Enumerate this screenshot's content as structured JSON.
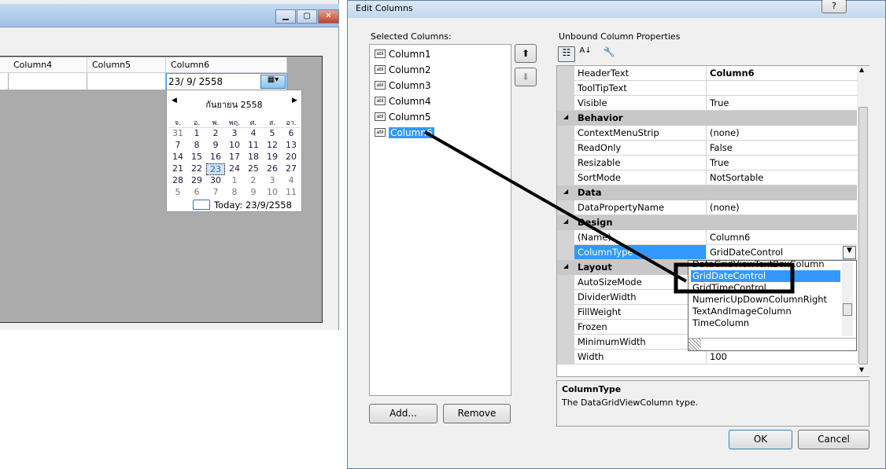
{
  "left_window": {
    "columns": [
      "Column4",
      "Column5",
      "Column6"
    ],
    "date_value": "23/ 9/ 2558",
    "calendar": {
      "month_title": "กันยายน 2558",
      "weekdays": [
        "จ.",
        "อ.",
        "พ.",
        "พฤ.",
        "ศ.",
        "ส.",
        "อา."
      ],
      "weeks": [
        [
          "31",
          "1",
          "2",
          "3",
          "4",
          "5",
          "6"
        ],
        [
          "7",
          "8",
          "9",
          "10",
          "11",
          "12",
          "13"
        ],
        [
          "14",
          "15",
          "16",
          "17",
          "18",
          "19",
          "20"
        ],
        [
          "21",
          "22",
          "23",
          "24",
          "25",
          "26",
          "27"
        ],
        [
          "28",
          "29",
          "30",
          "1",
          "2",
          "3",
          "4"
        ],
        [
          "5",
          "6",
          "7",
          "8",
          "9",
          "10",
          "11"
        ]
      ],
      "selected_day": "23",
      "today": "Today: 23/9/2558"
    }
  },
  "dialog": {
    "title": "Edit Columns",
    "help": "?",
    "selected_columns_label": "Selected Columns:",
    "columns": [
      "Column1",
      "Column2",
      "Column3",
      "Column4",
      "Column5",
      "Column6"
    ],
    "selected_column": "Column6",
    "add": "Add...",
    "remove": "Remove",
    "properties_label": "Unbound Column Properties",
    "properties": [
      {
        "name": "HeaderText",
        "value": "Column6"
      },
      {
        "name": "ToolTipText",
        "value": ""
      },
      {
        "name": "Visible",
        "value": "True"
      },
      {
        "category": "Behavior"
      },
      {
        "name": "ContextMenuStrip",
        "value": "(none)"
      },
      {
        "name": "ReadOnly",
        "value": "False"
      },
      {
        "name": "Resizable",
        "value": "True"
      },
      {
        "name": "SortMode",
        "value": "NotSortable"
      },
      {
        "category": "Data"
      },
      {
        "name": "DataPropertyName",
        "value": "(none)"
      },
      {
        "category": "Design"
      },
      {
        "name": "(Name)",
        "value": "Column6"
      },
      {
        "name": "ColumnType",
        "value": "GridDateControl"
      },
      {
        "category": "Layout"
      },
      {
        "name": "AutoSizeMode",
        "value": ""
      },
      {
        "name": "DividerWidth",
        "value": ""
      },
      {
        "name": "FillWeight",
        "value": ""
      },
      {
        "name": "Frozen",
        "value": ""
      },
      {
        "name": "MinimumWidth",
        "value": ""
      },
      {
        "name": "Width",
        "value": "100"
      }
    ],
    "dropdown_options": [
      "DataGridViewTextBoxColumn",
      "GridDateControl",
      "GridTimeControl",
      "NumericUpDownColumnRight",
      "TextAndImageColumn",
      "TimeColumn"
    ],
    "dropdown_selected": "GridDateControl",
    "description_title": "ColumnType",
    "description_text": "The DataGridViewColumn type.",
    "ok": "OK",
    "cancel": "Cancel"
  },
  "colors": {
    "selection": "#3399ff",
    "grid_bg": "#ababab"
  }
}
